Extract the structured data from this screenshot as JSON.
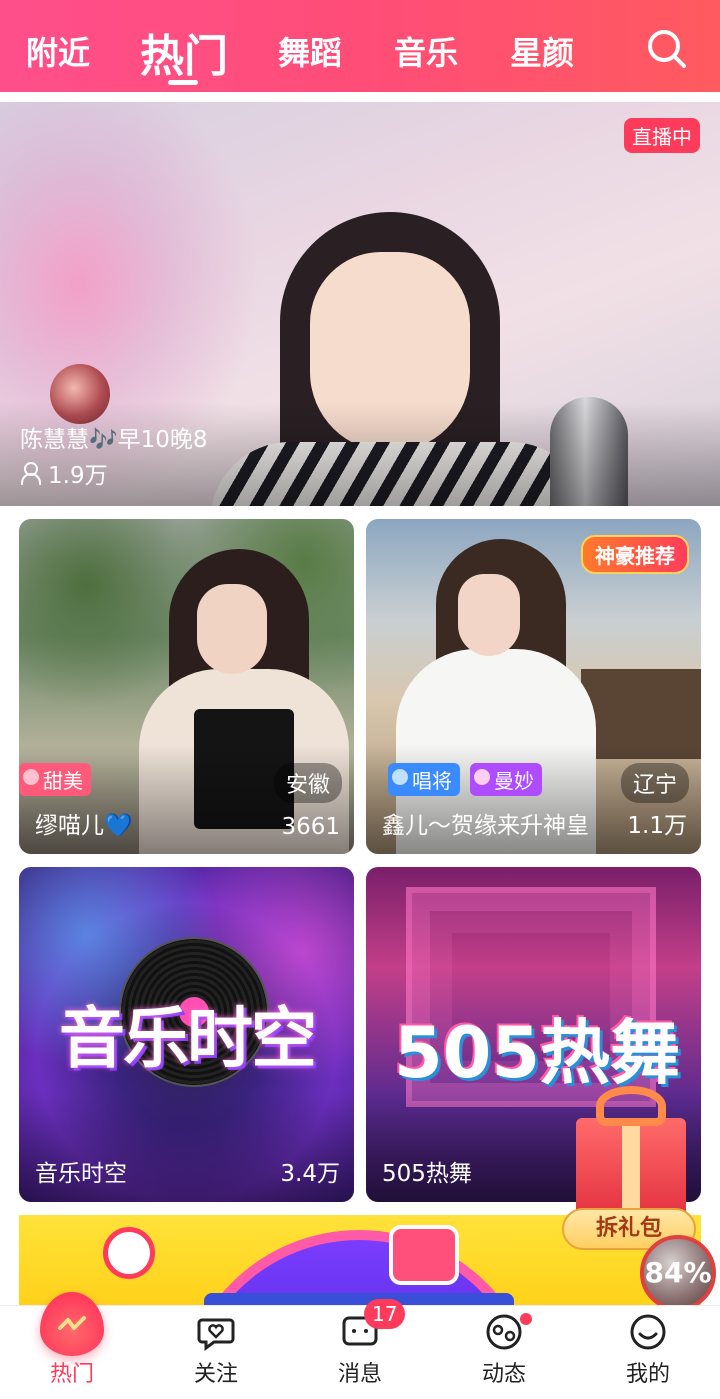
{
  "top_tabs": {
    "items": [
      "附近",
      "热门",
      "舞蹈",
      "音乐",
      "星颜"
    ],
    "active_index": 1,
    "overflow_glyph": "｜"
  },
  "featured": {
    "badge": "直播中",
    "title": "陈慧慧🎶早10晚8",
    "viewers": "1.9万"
  },
  "cards": [
    {
      "name": "缪喵儿💙",
      "count": "3661",
      "region": "安徽",
      "tags": [
        "甜美"
      ]
    },
    {
      "name": "鑫儿～贺缘来升神皇",
      "count": "1.1万",
      "region": "辽宁",
      "tags": [
        "唱将",
        "曼妙"
      ],
      "badge": "神豪推荐"
    },
    {
      "name": "音乐时空",
      "count": "3.4万",
      "art_text": "音乐时空"
    },
    {
      "name": "505热舞",
      "art_text": "505热舞"
    }
  ],
  "gift": {
    "label": "拆礼包"
  },
  "progress": {
    "text": "84%"
  },
  "bottom_nav": {
    "items": [
      "热门",
      "关注",
      "消息",
      "动态",
      "我的"
    ],
    "active_index": 0,
    "message_badge": "17"
  },
  "colors": {
    "accent": "#ff3b5c",
    "topbar_start": "#ff4f8b",
    "topbar_end": "#ff5a5f"
  },
  "icons": {
    "search": "search-icon",
    "viewers": "person-icon",
    "nav": [
      "flame-icon",
      "heart-chat-icon",
      "message-icon",
      "moments-icon",
      "smile-icon"
    ]
  }
}
